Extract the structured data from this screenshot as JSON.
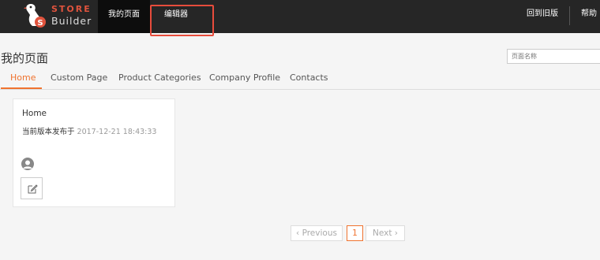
{
  "brand": {
    "line1": "STORE",
    "line2": "Builder"
  },
  "nav": {
    "my_pages": "我的页面",
    "editor": "编辑器",
    "back_to_old": "回到旧版",
    "help": "帮助"
  },
  "page": {
    "title": "我的页面",
    "search_placeholder": "页面名称"
  },
  "tabs": [
    "Home",
    "Custom Page",
    "Product Categories",
    "Company Profile",
    "Contacts"
  ],
  "card": {
    "title": "Home",
    "published_label": "当前版本发布于",
    "published_at": "2017-12-21 18:43:33"
  },
  "pagination": {
    "previous": "Previous",
    "current_page": "1",
    "next": "Next"
  },
  "colors": {
    "accent": "#f0732f",
    "topbar": "#262626",
    "highlight": "#e74c3c"
  }
}
